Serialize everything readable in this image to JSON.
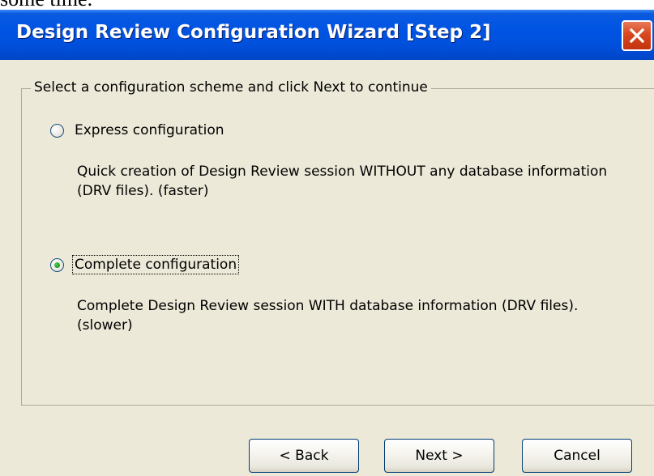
{
  "page": {
    "context_text": "some time."
  },
  "window": {
    "title": "Design Review Configuration Wizard [Step 2]",
    "close_icon": "close-x-icon"
  },
  "group": {
    "legend": "Select a configuration scheme and click Next to continue"
  },
  "options": [
    {
      "label": "Express configuration",
      "description": "Quick creation of Design Review session WITHOUT any database information (DRV files). (faster)",
      "selected": false
    },
    {
      "label": "Complete configuration",
      "description": "Complete Design Review session WITH database information (DRV files). (slower)",
      "selected": true
    }
  ],
  "buttons": {
    "back": "< Back",
    "next": "Next >",
    "cancel": "Cancel"
  },
  "colors": {
    "titlebar": "#0054e3",
    "dialog_background": "#ece9d8",
    "close_button": "#d8471f",
    "radio_selected_dot": "#21a121"
  }
}
